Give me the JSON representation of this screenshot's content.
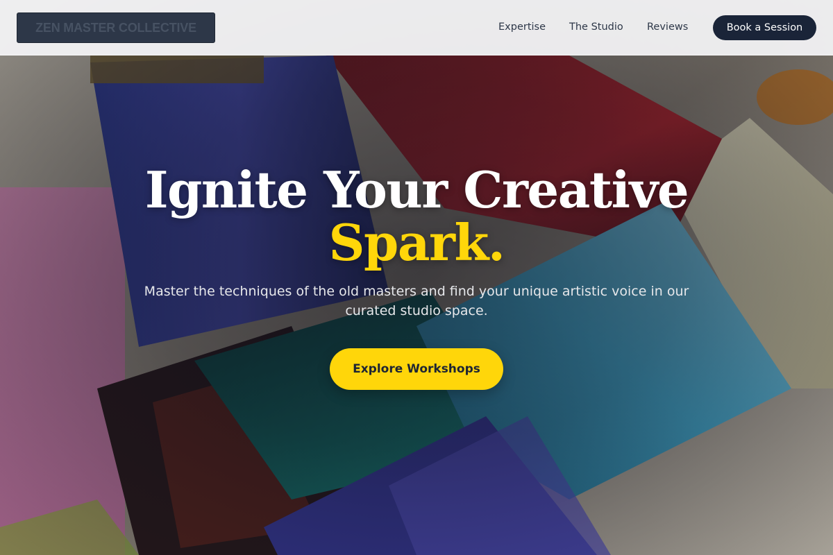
{
  "header": {
    "logo_text": "ZEN MASTER COLLECTIVE",
    "nav": [
      {
        "label": "Expertise"
      },
      {
        "label": "The Studio"
      },
      {
        "label": "Reviews"
      }
    ],
    "book_label": "Book a Session"
  },
  "hero": {
    "title_line1": "Ignite Your Creative",
    "title_line2": "Spark.",
    "subtitle": "Master the techniques of the old masters and find your unique artistic voice in our curated studio space.",
    "cta_label": "Explore Workshops"
  },
  "colors": {
    "accent": "#ffd60a",
    "navy": "#1a2438",
    "header_bg": "#f5f5f7"
  },
  "background": {
    "icon": "paint-brushes-photo"
  }
}
